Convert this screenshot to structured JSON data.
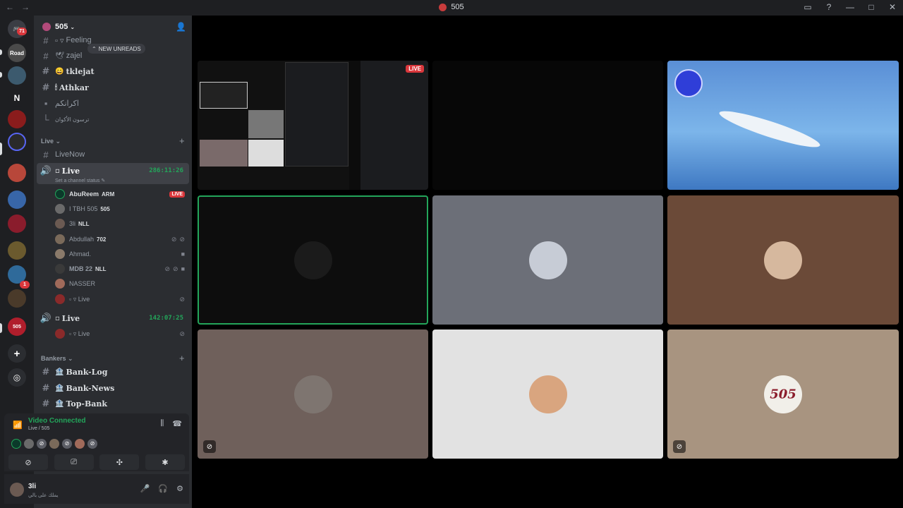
{
  "window": {
    "title": "505"
  },
  "server": {
    "name": "505"
  },
  "guild_badges": {
    "home_count": "71",
    "server_count": "1"
  },
  "new_unreads": "NEW UNREADS",
  "channels_top": [
    {
      "name": "Feeling"
    },
    {
      "name": "zajel"
    },
    {
      "name": "tklejat"
    },
    {
      "name": "Athkar"
    },
    {
      "name": "اكرانكم"
    },
    {
      "name": "ترسون الأكوان"
    }
  ],
  "live_category": "Live",
  "live_channels": {
    "livenow": "LiveNow",
    "live1": {
      "name": "Live",
      "timer": "286:11:26",
      "status": "Set a channel status"
    },
    "live2": {
      "name": "Live",
      "timer": "142:07:25"
    }
  },
  "voice_users_1": [
    {
      "name": "AbuReem",
      "tag": "ARM",
      "live": "LIVE"
    },
    {
      "name": "I TBH 505",
      "tag": "505"
    },
    {
      "name": "3li",
      "tag": "NLL"
    },
    {
      "name": "Abdullah",
      "tag": "702"
    },
    {
      "name": "Ahmad."
    },
    {
      "name": "MDB 22",
      "tag": "NLL"
    },
    {
      "name": "NASSER"
    },
    {
      "name": "Live"
    }
  ],
  "voice_users_2": [
    {
      "name": "Live"
    }
  ],
  "bankers_category": "Bankers",
  "bankers_channels": [
    "Bank-Log",
    "Bank-News",
    "Top-Bank"
  ],
  "voice_panel": {
    "status": "Video Connected",
    "channel": "Live / 505"
  },
  "user": {
    "name": "3li",
    "custom_status": "يملك على بالي"
  },
  "colors": {
    "green": "#23a55a",
    "red": "#da373c",
    "sidebar": "#2b2d31",
    "rail": "#1e1f22"
  },
  "stage": {
    "live_label": "LIVE",
    "brand_tile": "505"
  }
}
